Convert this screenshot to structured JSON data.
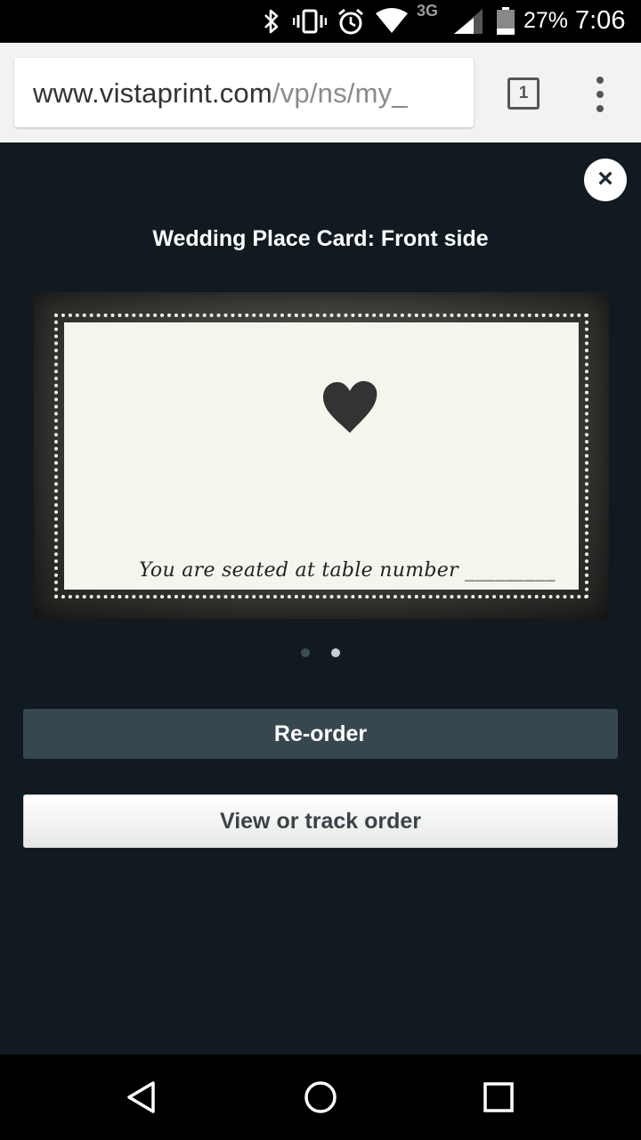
{
  "status_bar": {
    "icons": [
      "bluetooth-icon",
      "vibrate-icon",
      "alarm-icon",
      "wifi-icon",
      "cell-signal-3g-icon",
      "battery-icon"
    ],
    "network_label": "3G",
    "battery_percent": "27%",
    "time": "7:06"
  },
  "browser": {
    "url_host": "www.vistaprint.com",
    "url_path": "/vp/ns/my_",
    "tab_count": "1",
    "menu_icon": "overflow-menu-icon"
  },
  "preview": {
    "close_label": "×",
    "title": "Wedding Place Card: Front side",
    "card": {
      "icon": "heart-icon",
      "text": "You are seated at table number _________"
    },
    "pager": {
      "pages": 2,
      "active_index": 1
    }
  },
  "actions": {
    "reorder_label": "Re-order",
    "view_track_label": "View or track order"
  },
  "nav_bar": {
    "icons": [
      "back-icon",
      "home-icon",
      "recents-icon"
    ]
  },
  "colors": {
    "page_background": "#101a20",
    "reorder_button": "#37474f",
    "browser_toolbar": "#f2f2f2"
  }
}
